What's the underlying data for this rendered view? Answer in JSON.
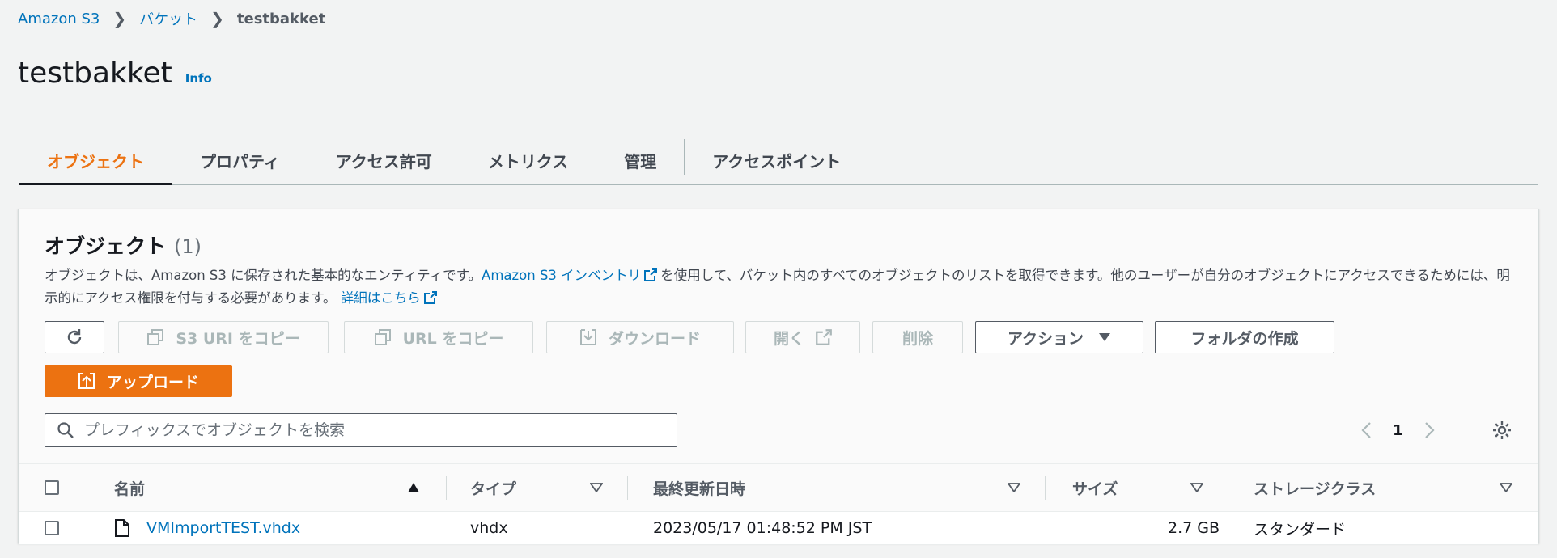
{
  "breadcrumb": {
    "items": [
      "Amazon S3",
      "バケット"
    ],
    "current": "testbakket"
  },
  "page": {
    "title": "testbakket",
    "info": "Info"
  },
  "tabs": [
    {
      "label": "オブジェクト",
      "active": true
    },
    {
      "label": "プロパティ"
    },
    {
      "label": "アクセス許可"
    },
    {
      "label": "メトリクス"
    },
    {
      "label": "管理"
    },
    {
      "label": "アクセスポイント"
    }
  ],
  "objects_panel": {
    "title": "オブジェクト",
    "count": "(1)",
    "description": {
      "part1": "オブジェクトは、Amazon S3 に保存された基本的なエンティティです。",
      "inventory_link": "Amazon S3 インベントリ",
      "part2": "を使用して、バケット内のすべてのオブジェクトのリストを取得できます。他のユーザーが自分のオブジェクトにアクセスできるためには、明示的にアクセス権限を付与する必要があります。",
      "details_link": "詳細はこちら"
    }
  },
  "toolbar": {
    "copy_s3_uri": "S3 URI をコピー",
    "copy_url": "URL をコピー",
    "download": "ダウンロード",
    "open": "開く",
    "delete": "削除",
    "actions": "アクション",
    "create_folder": "フォルダの作成",
    "upload": "アップロード"
  },
  "search": {
    "placeholder": "プレフィックスでオブジェクトを検索"
  },
  "pagination": {
    "current_page": "1"
  },
  "table": {
    "headers": {
      "name": "名前",
      "type": "タイプ",
      "last_modified": "最終更新日時",
      "size": "サイズ",
      "storage_class": "ストレージクラス"
    },
    "rows": [
      {
        "name": "VMImportTEST.vhdx",
        "type": "vhdx",
        "last_modified": "2023/05/17 01:48:52 PM JST",
        "size": "2.7 GB",
        "storage_class": "スタンダード"
      }
    ]
  },
  "colors": {
    "link": "#0073bb",
    "accent": "#ec7211",
    "text": "#16191f",
    "muted": "#545b64"
  }
}
